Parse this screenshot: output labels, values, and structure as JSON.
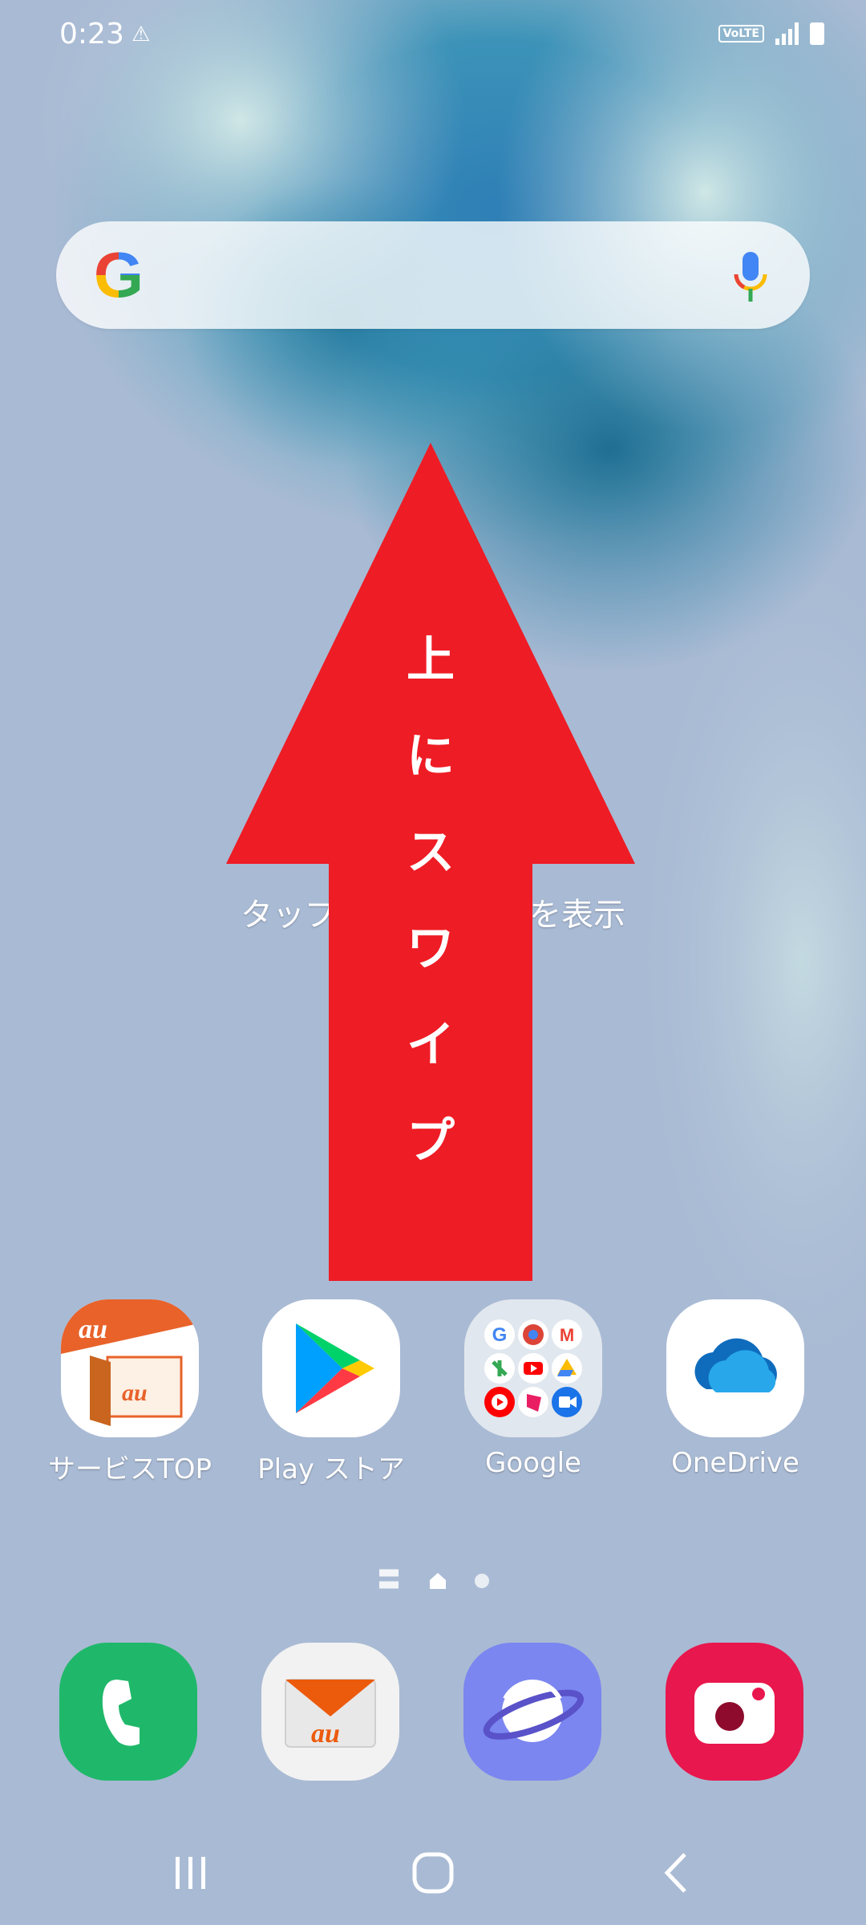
{
  "status_bar": {
    "time": "0:23",
    "warning_icon": "warning-icon",
    "volte": "VoLTE",
    "signal_icon": "signal-icon",
    "battery_icon": "battery-icon"
  },
  "search_widget": {
    "logo": "G",
    "mic_icon": "mic-icon"
  },
  "hint_text": "タップ　　　　　　を表示",
  "overlay": {
    "arrow_color": "#ee1c25",
    "label_chars": [
      "上",
      "に",
      "ス",
      "ワ",
      "イ",
      "プ"
    ]
  },
  "apps": [
    {
      "label": "サービスTOP",
      "icon": "au-service-top-icon"
    },
    {
      "label": "Play ストア",
      "icon": "play-store-icon"
    },
    {
      "label": "Google",
      "icon": "google-folder-icon"
    },
    {
      "label": "OneDrive",
      "icon": "onedrive-icon"
    }
  ],
  "page_indicator": {
    "lines": "〓"
  },
  "dock": [
    {
      "name": "phone",
      "icon": "phone-icon",
      "color": "#1fb86a"
    },
    {
      "name": "au-mail",
      "icon": "au-mail-icon",
      "color": "#f2f2f2"
    },
    {
      "name": "internet",
      "icon": "internet-icon",
      "color": "#7b86f0"
    },
    {
      "name": "camera",
      "icon": "camera-icon",
      "color": "#e8174d"
    }
  ],
  "au_logo": "au"
}
